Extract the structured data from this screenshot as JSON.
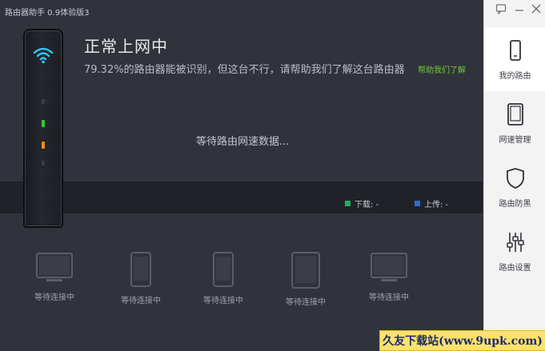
{
  "window": {
    "title": "路由器助手 0.9体验版3"
  },
  "status": {
    "title": "正常上网中",
    "subtitle": "79.32%的路由器能被识别，但这台不行，请帮助我们了解这台路由器",
    "help_link": "帮助我们了解"
  },
  "speed": {
    "waiting": "等待路由网速数据...",
    "download_label": "下载: -",
    "upload_label": "上传: -",
    "download_color": "#1fae60",
    "upload_color": "#2d6fd3"
  },
  "router": {
    "led_colors": [
      "#3a3d44",
      "#39c43a",
      "#ef8a1f",
      "#3a3d44"
    ],
    "wifi_color": "#2ec7f3"
  },
  "devices": [
    {
      "icon": "monitor-icon",
      "label": "等待连接中"
    },
    {
      "icon": "phone-icon",
      "label": "等待连接中"
    },
    {
      "icon": "phone-icon",
      "label": "等待连接中"
    },
    {
      "icon": "tablet-icon",
      "label": "等待连接中"
    },
    {
      "icon": "monitor-icon",
      "label": "等待连接中"
    }
  ],
  "sidebar": {
    "items": [
      {
        "label": "我的路由",
        "icon": "router-icon",
        "active": true
      },
      {
        "label": "网速管理",
        "icon": "tablet-icon",
        "active": false
      },
      {
        "label": "路由防黑",
        "icon": "shield-icon",
        "active": false
      },
      {
        "label": "路由设置",
        "icon": "sliders-icon",
        "active": false
      }
    ]
  },
  "watermark": "久友下载站(www.9upk.com)"
}
